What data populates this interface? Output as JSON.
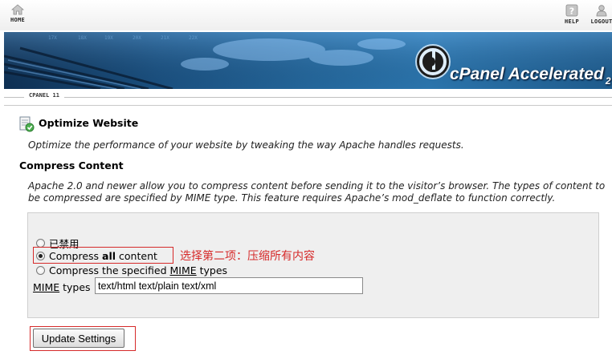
{
  "nav": {
    "home_label": "HOME",
    "help_label": "HELP",
    "logout_label": "LOGOUT"
  },
  "banner": {
    "brand_text": "cPanel Accelerated",
    "brand_version": "2"
  },
  "version_tab": "CPANEL 11",
  "page": {
    "title": "Optimize Website",
    "description": "Optimize the performance of your website by tweaking the way Apache handles requests."
  },
  "compress": {
    "title": "Compress Content",
    "description": "Apache 2.0 and newer allow you to compress content before sending it to the visitor’s browser. The types of content to be compressed are specified by MIME type. This feature requires Apache’s mod_deflate to function correctly.",
    "options": [
      {
        "label": "已禁用",
        "checked": false
      },
      {
        "label_pre": "Compress ",
        "label_bold": "all",
        "label_post": " content",
        "checked": true
      },
      {
        "label_pre": "Compress the specified ",
        "label_u": "MIME",
        "label_post": " types",
        "checked": false
      }
    ],
    "annotation": "选择第二项：压缩所有内容",
    "mime_label_u": "MIME",
    "mime_label_post": " types",
    "mime_value": "text/html text/plain text/xml",
    "update_label": "Update Settings"
  },
  "colors": {
    "annotation_red": "#d62a2a",
    "banner_blue": "#24669a"
  },
  "icons": [
    "home-icon",
    "help-icon",
    "logout-icon",
    "cpanel-logo-icon",
    "optimize-page-icon"
  ]
}
